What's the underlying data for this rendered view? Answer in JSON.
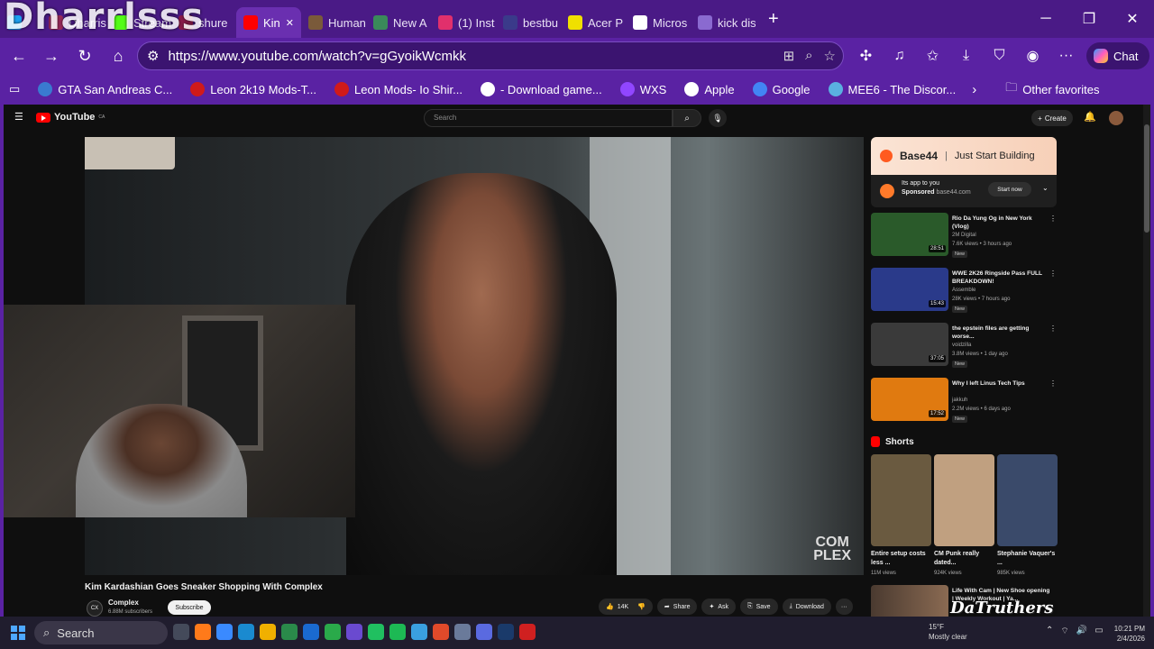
{
  "overlay": {
    "watermark": "Dharrlsss",
    "stream_name": "DaTruthers"
  },
  "browser": {
    "tabs": [
      {
        "label": "",
        "color": "#1da1f2"
      },
      {
        "label": "Dharris",
        "color": "#9a2a5a"
      },
      {
        "label": "Stream",
        "color": "#53fc18"
      },
      {
        "label": "shure",
        "color": "#8a1a4a"
      },
      {
        "label": "Kin",
        "color": "#ff0000"
      },
      {
        "label": "Human",
        "color": "#7a5a3a"
      },
      {
        "label": "New A",
        "color": "#3a8a5a"
      },
      {
        "label": "(1) Inst",
        "color": "#e1306c"
      },
      {
        "label": "bestbu",
        "color": "#3a3a8a"
      },
      {
        "label": "Acer P",
        "color": "#f0e000"
      },
      {
        "label": "Micros",
        "color": "#ffffff"
      },
      {
        "label": "kick dis",
        "color": "#8a6ad0"
      }
    ],
    "url": "https://www.youtube.com/watch?v=gGyoikWcmkk",
    "chat_label": "Chat",
    "bookmarks": [
      {
        "label": "GTA San Andreas C...",
        "color": "#3a7ad0"
      },
      {
        "label": "Leon 2k19 Mods-T...",
        "color": "#d01a1a"
      },
      {
        "label": "Leon Mods- Io Shir...",
        "color": "#d01a1a"
      },
      {
        "label": "- Download game...",
        "color": "#ffffff"
      },
      {
        "label": "WXS",
        "color": "#9146ff"
      },
      {
        "label": "Apple",
        "color": "#ffffff"
      },
      {
        "label": "Google",
        "color": "#4285f4"
      },
      {
        "label": "MEE6 - The Discor...",
        "color": "#5ab0e0"
      }
    ],
    "other_favorites": "Other favorites"
  },
  "youtube": {
    "logo_text": "YouTube",
    "logo_badge": "CA",
    "search_placeholder": "Search",
    "create_label": "Create",
    "video_title": "Kim Kardashian Goes Sneaker Shopping With Complex",
    "channel_name": "Complex",
    "channel_subs": "6.88M subscribers",
    "subscribe_label": "Subscribe",
    "likes": "14K",
    "share_label": "Share",
    "ask_label": "Ask",
    "save_label": "Save",
    "download_label": "Download",
    "watermark_logo": "COM\nPLEX",
    "ad": {
      "brand": "Base44",
      "tagline": "Just Start Building",
      "line1": "Its app to you",
      "sponsored": "Sponsored",
      "domain": "base44.com",
      "cta": "Start now"
    },
    "recommended": [
      {
        "title": "Rio Da Yung Og in New York (Vlog)",
        "channel": "2M Digital",
        "meta": "7.6K views • 3 hours ago",
        "duration": "28:51",
        "badge": "New",
        "thumb": "#2a5a2a"
      },
      {
        "title": "WWE 2K26 Ringside Pass FULL BREAKDOWN!",
        "channel": "Assemble",
        "meta": "28K views • 7 hours ago",
        "duration": "15:43",
        "badge": "New",
        "thumb": "#2a3a8a"
      },
      {
        "title": "the epstein files are getting worse...",
        "channel": "voidzilla",
        "meta": "3.8M views • 1 day ago",
        "duration": "37:05",
        "badge": "New",
        "thumb": "#3a3a3a"
      },
      {
        "title": "Why I left Linus Tech Tips",
        "channel": "jakkuh",
        "meta": "2.2M views • 6 days ago",
        "duration": "17:52",
        "badge": "New",
        "thumb": "#e07a10"
      }
    ],
    "shorts_heading": "Shorts",
    "shorts": [
      {
        "title": "Entire setup costs less ...",
        "views": "11M views",
        "thumb": "#6a5a40"
      },
      {
        "title": "CM Punk really dated...",
        "views": "924K views",
        "thumb": "#c0a080"
      },
      {
        "title": "Stephanie Vaquer's ...",
        "views": "985K views",
        "thumb": "#3a4a6a"
      }
    ],
    "next_title": "Life With Cam | New Shoe opening | Weekly Workout | Ya..."
  },
  "taskbar": {
    "search_label": "Search",
    "temp": "15°F",
    "weather": "Mostly clear",
    "time": "10:21 PM",
    "date": "2/4/2026",
    "apps": [
      "#444a5a",
      "#ff7a1a",
      "#3a8aff",
      "#1a8ad0",
      "#f0b000",
      "#2a8a4a",
      "#1a6ad0",
      "#2aaa4a",
      "#6a4ad0",
      "#20c060",
      "#1db954",
      "#3aa0e0",
      "#e04a2a",
      "#6a7a9a",
      "#5a6ae0",
      "#1a3a6a",
      "#d02020"
    ]
  }
}
